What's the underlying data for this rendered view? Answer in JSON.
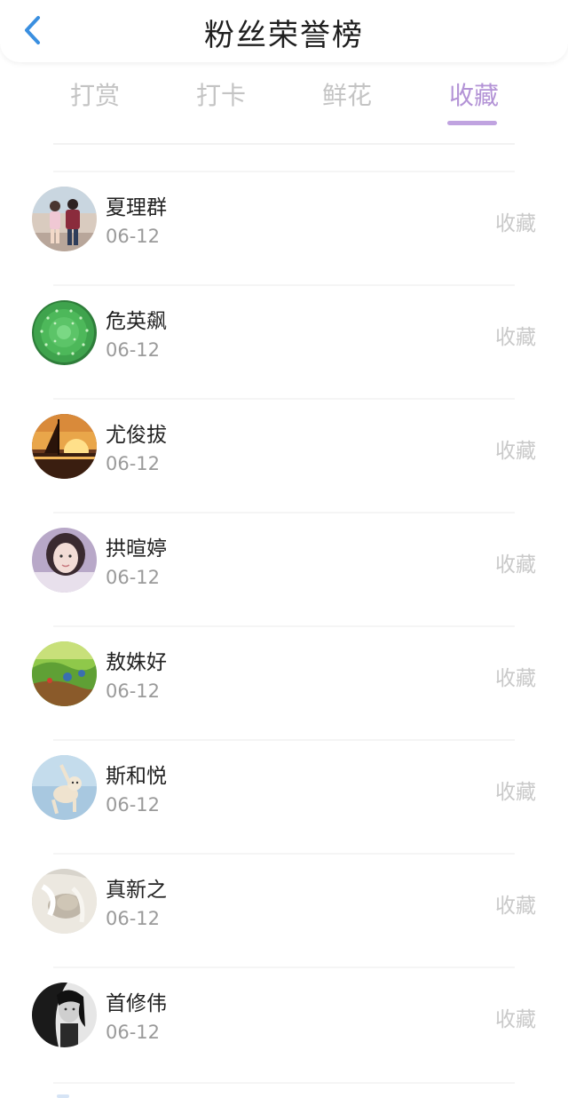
{
  "header": {
    "title": "粉丝荣誉榜",
    "back_icon": "chevron-left-icon",
    "accent_color": "#3a8fe0"
  },
  "tabs": [
    {
      "label": "打赏",
      "active": false
    },
    {
      "label": "打卡",
      "active": false
    },
    {
      "label": "鲜花",
      "active": false
    },
    {
      "label": "收藏",
      "active": true
    }
  ],
  "tab_active_color": "#b393d6",
  "list": [
    {
      "name": "夏理群",
      "date": "06-12",
      "action": "收藏",
      "avatar_icon": "couple-photo-avatar"
    },
    {
      "name": "危英飙",
      "date": "06-12",
      "action": "收藏",
      "avatar_icon": "cactus-avatar"
    },
    {
      "name": "尤俊拔",
      "date": "06-12",
      "action": "收藏",
      "avatar_icon": "sunset-sailboat-avatar"
    },
    {
      "name": "拱暄婷",
      "date": "06-12",
      "action": "收藏",
      "avatar_icon": "girl-portrait-avatar"
    },
    {
      "name": "敖姝好",
      "date": "06-12",
      "action": "收藏",
      "avatar_icon": "game-landscape-avatar"
    },
    {
      "name": "斯和悦",
      "date": "06-12",
      "action": "收藏",
      "avatar_icon": "dancing-cat-avatar"
    },
    {
      "name": "真新之",
      "date": "06-12",
      "action": "收藏",
      "avatar_icon": "sleeping-kitten-avatar"
    },
    {
      "name": "首修伟",
      "date": "06-12",
      "action": "收藏",
      "avatar_icon": "bw-portrait-avatar"
    }
  ]
}
